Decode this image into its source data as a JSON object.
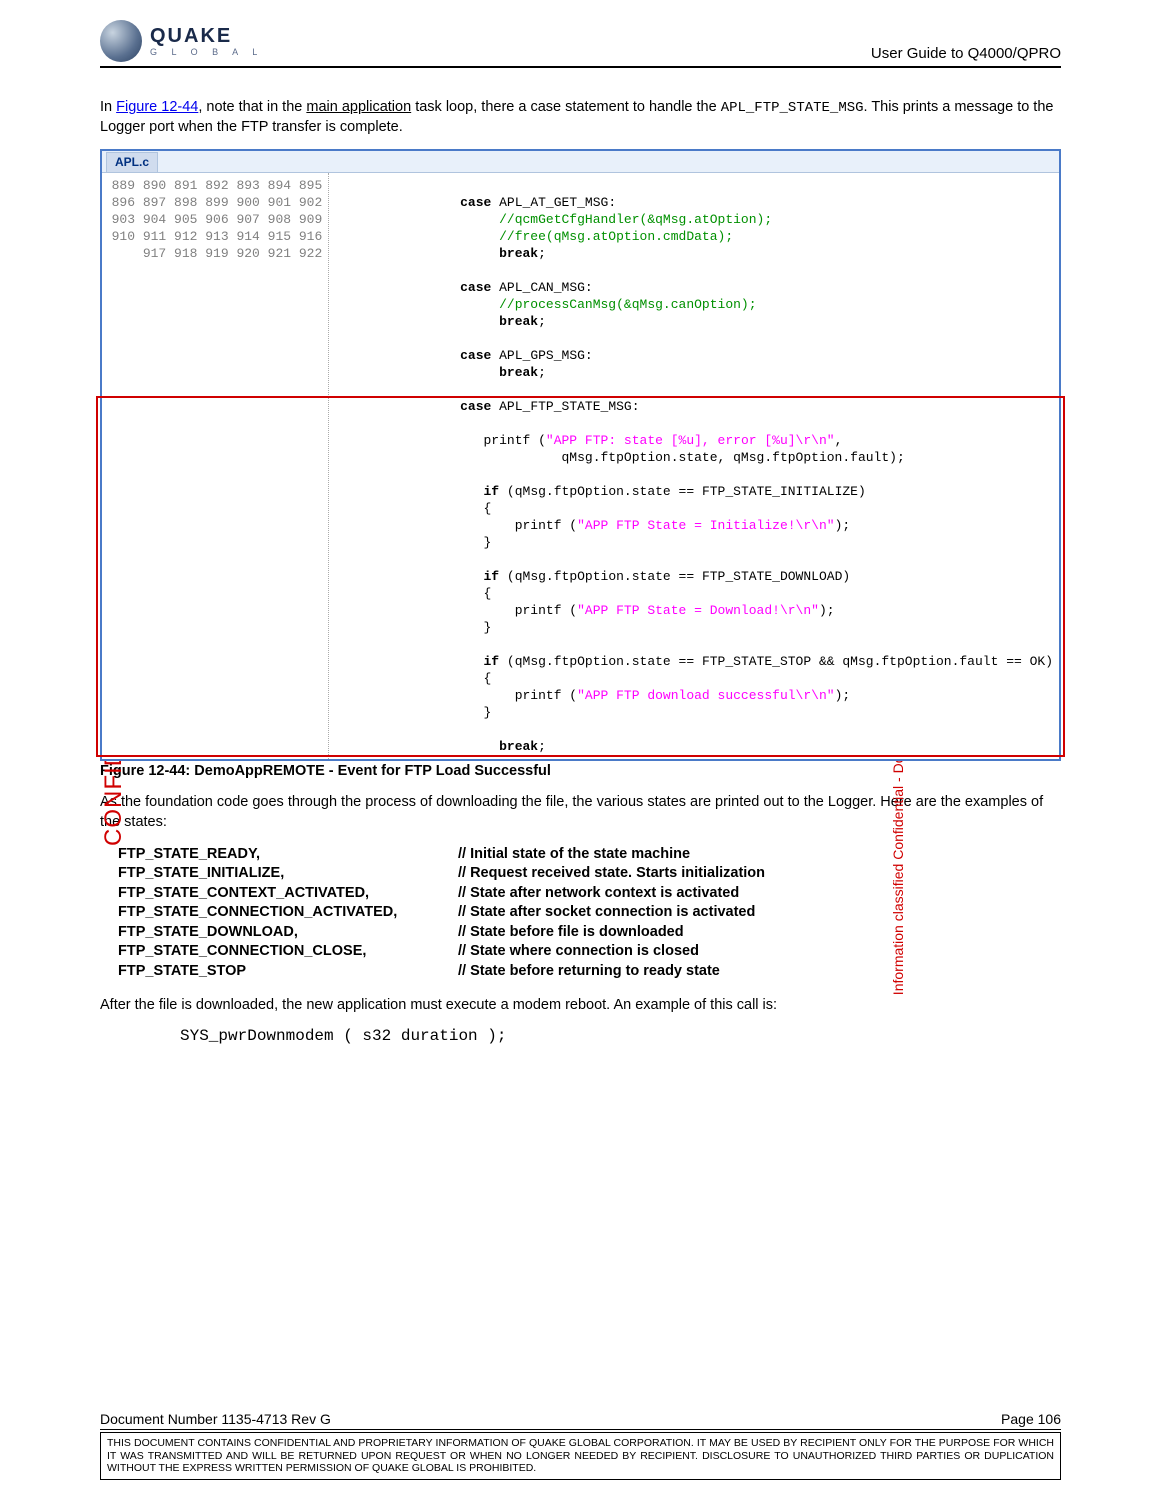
{
  "header": {
    "logo_top": "QUAKE",
    "logo_bottom": "G L O B A L",
    "right": "User Guide to Q4000/QPRO"
  },
  "para1": {
    "pre": "In ",
    "figref": "Figure 12-44",
    "mid1": ", note that in the ",
    "underlined": "main application",
    "mid2": " task loop, there a case statement to handle the ",
    "mono": "APL_FTP_STATE_MSG",
    "post": ".  This prints a message to the Logger port when the FTP transfer is complete."
  },
  "codewin": {
    "tab": "APL.c",
    "line_start": 889,
    "line_end": 922,
    "lines": [
      {
        "n": 889,
        "t": "",
        "cls": ""
      },
      {
        "n": 890,
        "t": "                case APL_AT_GET_MSG:",
        "cls": "kw"
      },
      {
        "n": 891,
        "t": "                     //qcmGetCfgHandler(&qMsg.atOption);",
        "cls": "cmt"
      },
      {
        "n": 892,
        "t": "                     //free(qMsg.atOption.cmdData);",
        "cls": "cmt"
      },
      {
        "n": 893,
        "t": "                     break;",
        "cls": "kw"
      },
      {
        "n": 894,
        "t": "",
        "cls": ""
      },
      {
        "n": 895,
        "t": "                case APL_CAN_MSG:",
        "cls": "kw"
      },
      {
        "n": 896,
        "t": "                     //processCanMsg(&qMsg.canOption);",
        "cls": "cmt"
      },
      {
        "n": 897,
        "t": "                     break;",
        "cls": "kw"
      },
      {
        "n": 898,
        "t": "",
        "cls": ""
      },
      {
        "n": 899,
        "t": "                case APL_GPS_MSG:",
        "cls": "kw"
      },
      {
        "n": 900,
        "t": "                     break;",
        "cls": "kw"
      },
      {
        "n": 901,
        "t": "",
        "cls": ""
      },
      {
        "n": 902,
        "t": "                case APL_FTP_STATE_MSG:",
        "cls": "kw"
      },
      {
        "n": 903,
        "t": "",
        "cls": ""
      },
      {
        "n": 904,
        "t": "                   printf (\"APP FTP: state [%u], error [%u]\\r\\n\",",
        "cls": ""
      },
      {
        "n": 905,
        "t": "                             qMsg.ftpOption.state, qMsg.ftpOption.fault);",
        "cls": ""
      },
      {
        "n": 906,
        "t": "",
        "cls": ""
      },
      {
        "n": 907,
        "t": "                   if (qMsg.ftpOption.state == FTP_STATE_INITIALIZE)",
        "cls": ""
      },
      {
        "n": 908,
        "t": "                   {",
        "cls": ""
      },
      {
        "n": 909,
        "t": "                       printf (\"APP FTP State = Initialize!\\r\\n\");",
        "cls": ""
      },
      {
        "n": 910,
        "t": "                   }",
        "cls": ""
      },
      {
        "n": 911,
        "t": "",
        "cls": ""
      },
      {
        "n": 912,
        "t": "                   if (qMsg.ftpOption.state == FTP_STATE_DOWNLOAD)",
        "cls": ""
      },
      {
        "n": 913,
        "t": "                   {",
        "cls": ""
      },
      {
        "n": 914,
        "t": "                       printf (\"APP FTP State = Download!\\r\\n\");",
        "cls": ""
      },
      {
        "n": 915,
        "t": "                   }",
        "cls": ""
      },
      {
        "n": 916,
        "t": "",
        "cls": ""
      },
      {
        "n": 917,
        "t": "                   if (qMsg.ftpOption.state == FTP_STATE_STOP && qMsg.ftpOption.fault == OK)",
        "cls": ""
      },
      {
        "n": 918,
        "t": "                   {",
        "cls": ""
      },
      {
        "n": 919,
        "t": "                       printf (\"APP FTP download successful\\r\\n\");",
        "cls": ""
      },
      {
        "n": 920,
        "t": "                   }",
        "cls": ""
      },
      {
        "n": 921,
        "t": "",
        "cls": ""
      },
      {
        "n": 922,
        "t": "                     break;",
        "cls": "kw"
      }
    ]
  },
  "caption": "Figure 12-44:  DemoAppREMOTE - Event for FTP Load Successful",
  "para2": "As the foundation code goes through the process of downloading the file, the various states are printed out to the Logger. Here are the examples of the states:",
  "states": [
    {
      "name": "FTP_STATE_READY,",
      "desc": "// Initial state of the state machine"
    },
    {
      "name": "FTP_STATE_INITIALIZE,",
      "desc": "// Request received state. Starts initialization"
    },
    {
      "name": "FTP_STATE_CONTEXT_ACTIVATED,",
      "desc": "// State after network context is activated"
    },
    {
      "name": "FTP_STATE_CONNECTION_ACTIVATED,",
      "desc": "// State after socket connection is activated"
    },
    {
      "name": "FTP_STATE_DOWNLOAD,",
      "desc": "// State before file is downloaded"
    },
    {
      "name": "FTP_STATE_CONNECTION_CLOSE,",
      "desc": "// State where connection is closed"
    },
    {
      "name": "FTP_STATE_STOP",
      "desc": "// State before returning to ready state"
    }
  ],
  "para3": "After the file is downloaded, the new application must execute a modem reboot.  An example of this call is:",
  "centercode": "SYS_pwrDownmodem ( s32 duration );",
  "footer": {
    "left": "Document Number 1135-4713   Rev G",
    "right": "Page 106",
    "disclaimer": "THIS DOCUMENT CONTAINS CONFIDENTIAL AND PROPRIETARY INFORMATION OF QUAKE GLOBAL CORPORATION.  IT MAY BE USED BY RECIPIENT ONLY FOR THE PURPOSE FOR WHICH IT WAS TRANSMITTED AND WILL BE RETURNED UPON REQUEST OR WHEN NO LONGER NEEDED BY RECIPIENT.  DISCLOSURE TO UNAUTHORIZED THIRD PARTIES OR DUPLICATION WITHOUT THE EXPRESS WRITTEN PERMISSION OF QUAKE GLOBAL IS PROHIBITED."
  },
  "watermark_left": "CONFIDENTIAL",
  "watermark_right": "Information classified Confidential - Do not copy (See last page for obligations)"
}
